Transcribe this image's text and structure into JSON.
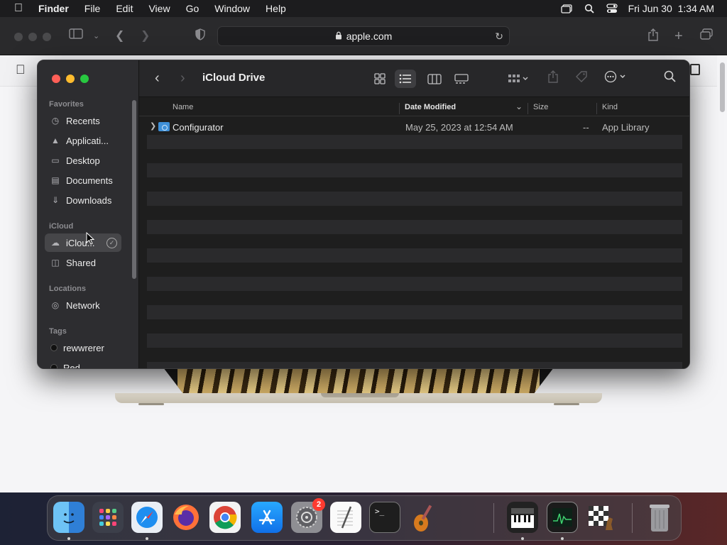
{
  "menubar": {
    "app_name": "Finder",
    "menus": [
      "File",
      "Edit",
      "View",
      "Go",
      "Window",
      "Help"
    ],
    "clock": "Fri Jun 30  1:34 AM"
  },
  "safari": {
    "address": "apple.com"
  },
  "finder": {
    "title": "iCloud Drive",
    "sidebar": {
      "favorites_label": "Favorites",
      "favorites": [
        "Recents",
        "Applicati...",
        "Desktop",
        "Documents",
        "Downloads"
      ],
      "icloud_label": "iCloud",
      "icloud": [
        "iClou...",
        "Shared"
      ],
      "locations_label": "Locations",
      "locations": [
        "Network"
      ],
      "tags_label": "Tags",
      "tags": [
        "rewwrerer",
        "Red"
      ]
    },
    "columns": {
      "name": "Name",
      "date": "Date Modified",
      "size": "Size",
      "kind": "Kind"
    },
    "rows": [
      {
        "name": "Configurator",
        "date": "May 25, 2023 at 12:54 AM",
        "size": "--",
        "kind": "App Library"
      }
    ]
  },
  "dock": {
    "settings_badge": "2"
  }
}
